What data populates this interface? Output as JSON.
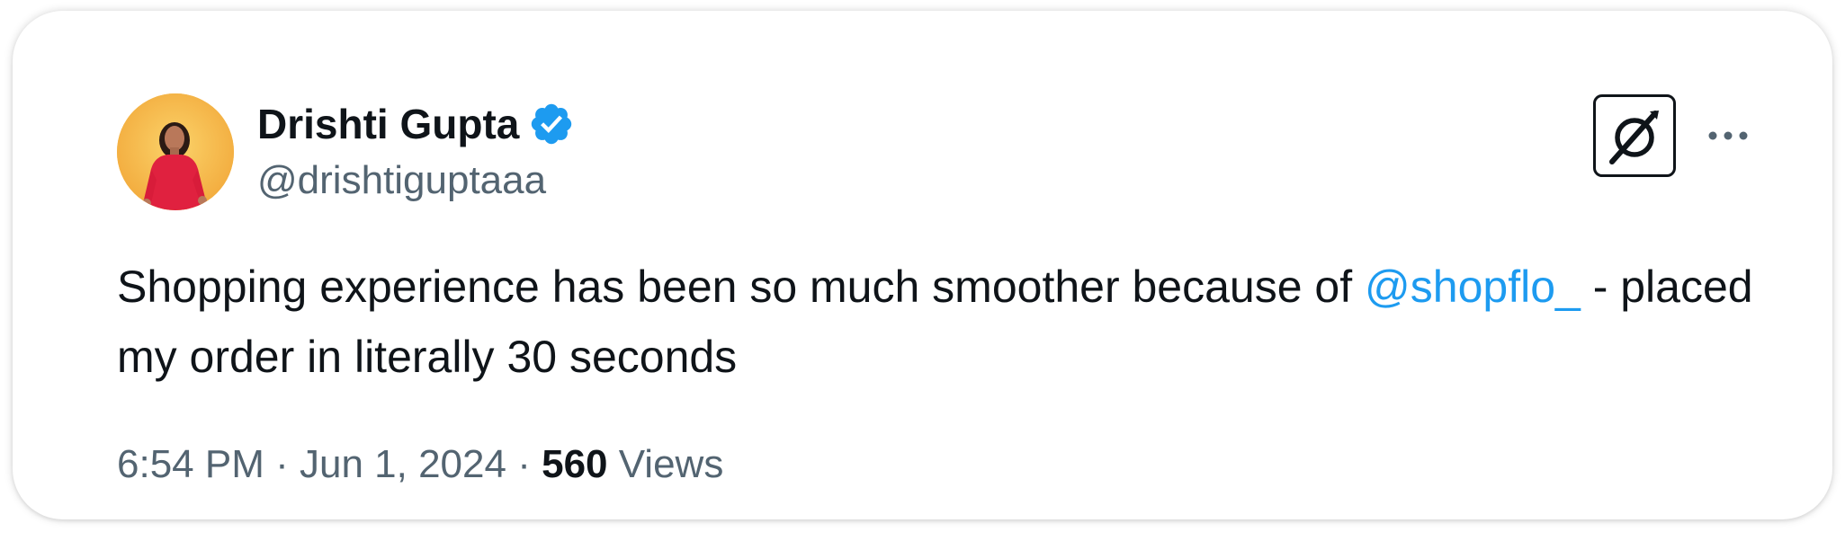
{
  "tweet": {
    "author": {
      "display_name": "Drishti Gupta",
      "handle": "@drishtiguptaaa",
      "verified_icon": "verified-badge-icon",
      "avatar": "avatar-photo"
    },
    "text_before_mention": "Shopping experience has been so much smoother because of ",
    "mention": "@shopflo_",
    "text_after_mention": " - placed my order in literally 30 seconds",
    "time": "6:54 PM",
    "separator": "·",
    "date": "Jun 1, 2024",
    "views_count": "560",
    "views_label": "Views"
  },
  "icons": {
    "logo": "x-logo-icon",
    "more": "more-options-icon"
  },
  "colors": {
    "text_primary": "#0f1419",
    "text_secondary": "#536471",
    "link": "#1d9bf0",
    "verified": "#1d9bf0",
    "avatar_bg": "#f6c04a"
  }
}
